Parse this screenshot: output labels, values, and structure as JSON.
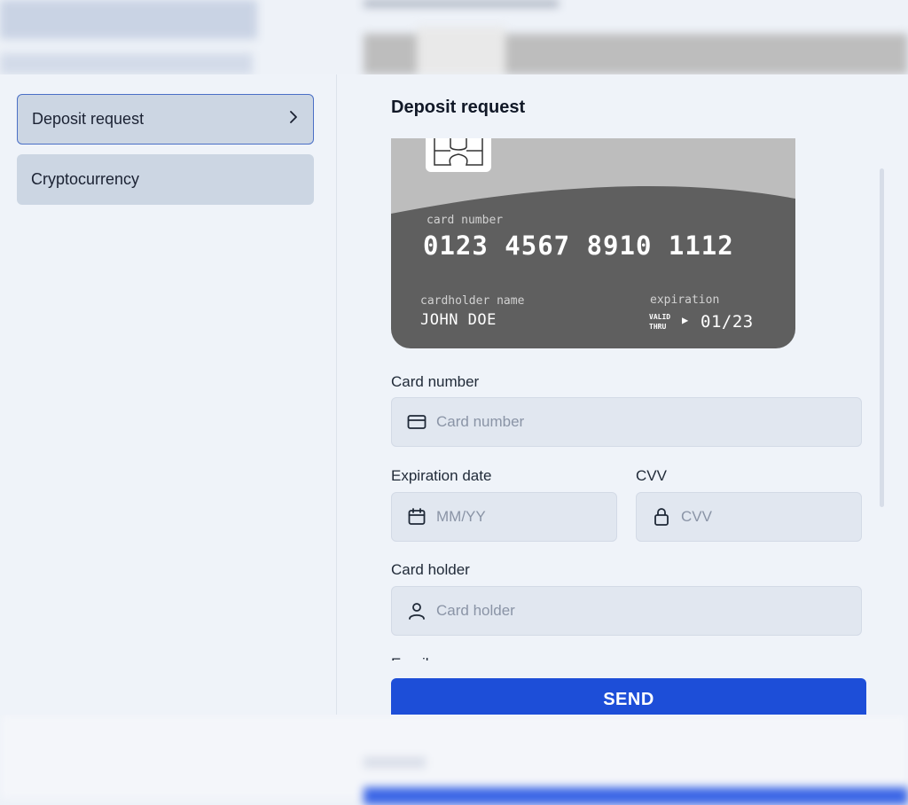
{
  "sidebar": {
    "items": [
      {
        "label": "Deposit request",
        "active": true,
        "icon": "chevron-right-icon"
      },
      {
        "label": "Cryptocurrency",
        "active": false
      }
    ]
  },
  "main": {
    "title": "Deposit request",
    "card_preview": {
      "number_label": "card number",
      "number": "0123 4567 8910 1112",
      "holder_label": "cardholder name",
      "holder": "JOHN DOE",
      "expiration_label": "expiration",
      "valid_thru": "VALID THRU",
      "expiration": "01/23",
      "colors": {
        "body": "#5f5f5f",
        "top": "#bdbdbd",
        "chip": "#ffffff"
      }
    },
    "form": {
      "card_number": {
        "label": "Card number",
        "placeholder": "Card number",
        "value": "",
        "icon": "credit-card-icon"
      },
      "expiration": {
        "label": "Expiration date",
        "placeholder": "MM/YY",
        "value": "",
        "icon": "calendar-icon"
      },
      "cvv": {
        "label": "CVV",
        "placeholder": "CVV",
        "value": "",
        "icon": "lock-icon"
      },
      "card_holder": {
        "label": "Card holder",
        "placeholder": "Card holder",
        "value": "",
        "icon": "user-icon"
      },
      "email_label_partial": "Email"
    },
    "send_label": "SEND"
  },
  "colors": {
    "accent": "#1d4ed8",
    "active_border": "#4a6fc6",
    "nav_bg": "#ccd6e3",
    "input_bg": "#e1e7f0"
  }
}
